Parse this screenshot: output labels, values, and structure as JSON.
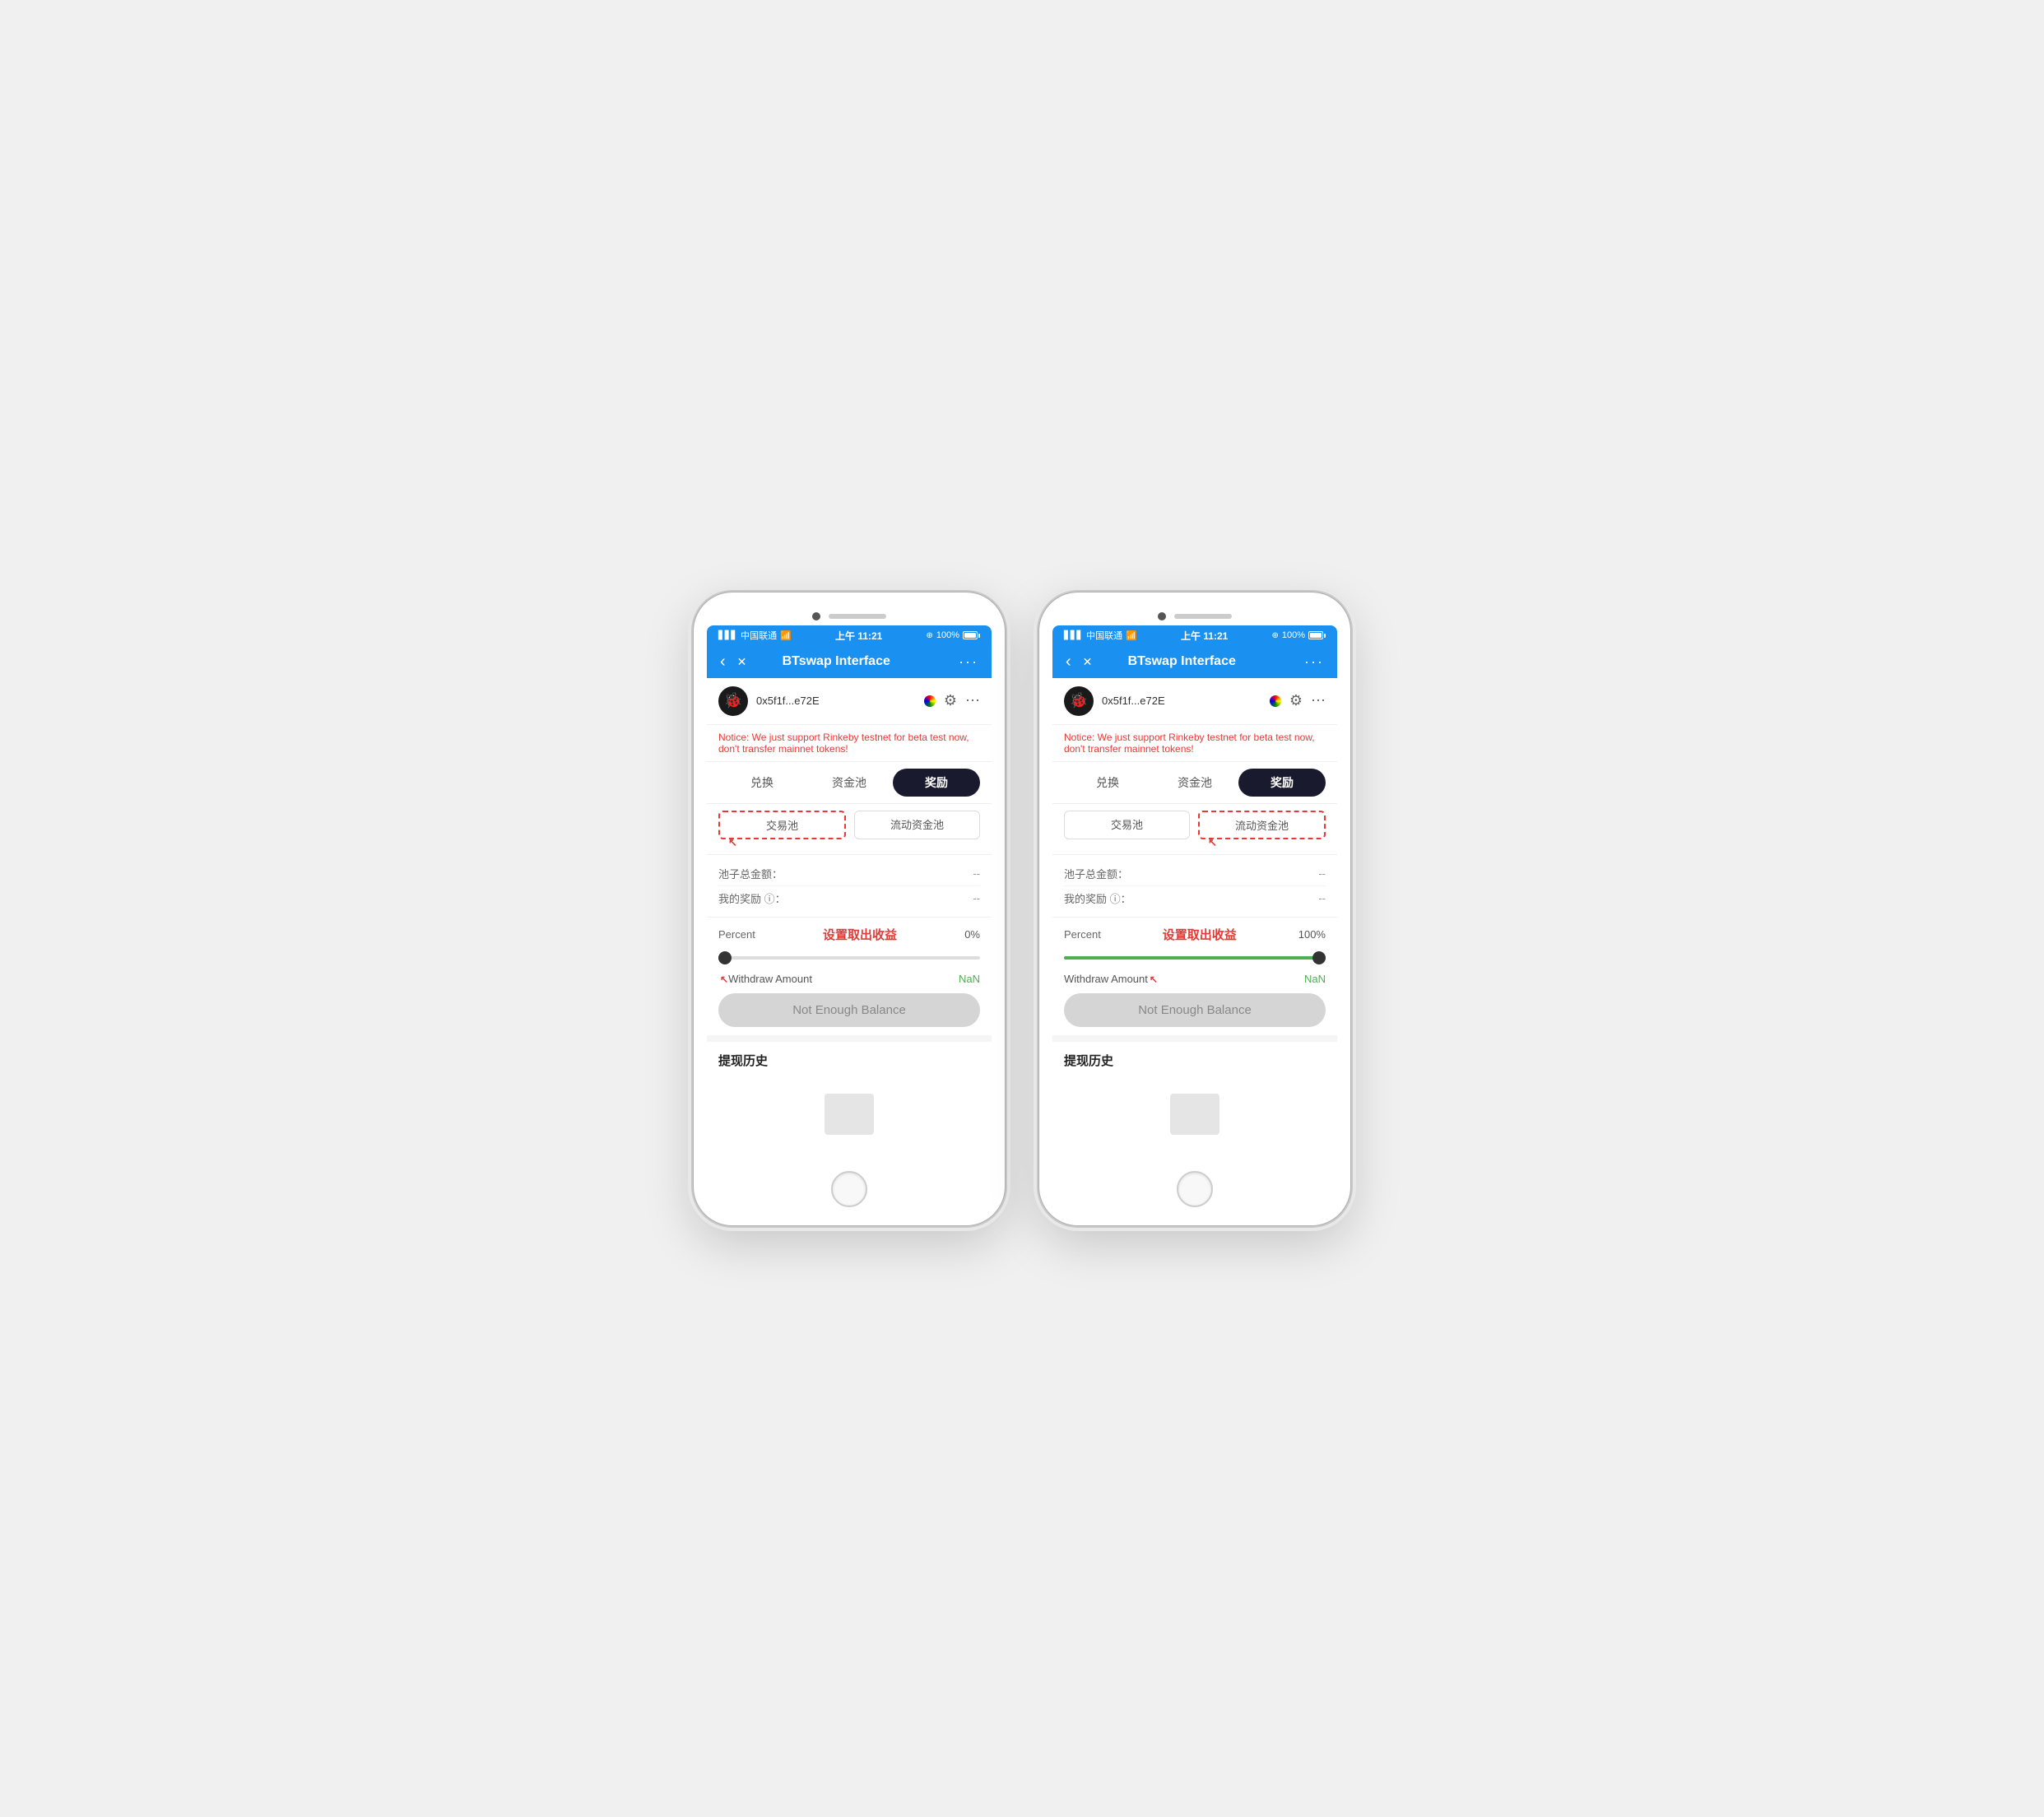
{
  "page": {
    "background": "#f0f0f0"
  },
  "phones": [
    {
      "id": "phone-left",
      "status_bar": {
        "carrier": "中国联通",
        "wifi": "WiFi",
        "time": "上午 11:21",
        "network_icon": "⊕",
        "battery": "100%"
      },
      "app_bar": {
        "back_label": "‹",
        "close_label": "✕",
        "title": "BTswap Interface",
        "more_label": "···"
      },
      "profile": {
        "avatar": "🐞",
        "address": "0x5f1f...e72E",
        "colorful_dot": true,
        "settings_icon": "⚙",
        "more_icon": "⋯"
      },
      "notice": "Notice: We just support Rinkeby testnet for beta test now, don't transfer mainnet tokens!",
      "tabs": [
        {
          "label": "兑换",
          "active": false,
          "dashed": false
        },
        {
          "label": "资金池",
          "active": false,
          "dashed": false
        },
        {
          "label": "奖励",
          "active": true,
          "dashed": true
        }
      ],
      "sub_tabs": [
        {
          "label": "交易池",
          "active": false,
          "dashed": true
        },
        {
          "label": "流动资金池",
          "active": false,
          "dashed": false
        }
      ],
      "active_sub_tab": "交易池",
      "info_rows": [
        {
          "label": "池子总金额：",
          "value": "--"
        },
        {
          "label": "我的奖励 ⓘ：",
          "value": "--"
        }
      ],
      "percent": {
        "label": "Percent",
        "title_cn": "设置取出收益",
        "value": "0%",
        "slider_position": "left"
      },
      "withdraw": {
        "label": "Withdraw Amount",
        "value": "NaN",
        "arrow_side": "left"
      },
      "balance_button": "Not Enough Balance",
      "history": {
        "title": "提现历史"
      }
    },
    {
      "id": "phone-right",
      "status_bar": {
        "carrier": "中国联通",
        "wifi": "WiFi",
        "time": "上午 11:21",
        "network_icon": "⊕",
        "battery": "100%"
      },
      "app_bar": {
        "back_label": "‹",
        "close_label": "✕",
        "title": "BTswap Interface",
        "more_label": "···"
      },
      "profile": {
        "avatar": "🐞",
        "address": "0x5f1f...e72E",
        "colorful_dot": true,
        "settings_icon": "⚙",
        "more_icon": "⋯"
      },
      "notice": "Notice: We just support Rinkeby testnet for beta test now, don't transfer mainnet tokens!",
      "tabs": [
        {
          "label": "兑换",
          "active": false,
          "dashed": false
        },
        {
          "label": "资金池",
          "active": false,
          "dashed": false
        },
        {
          "label": "奖励",
          "active": true,
          "dashed": false
        }
      ],
      "sub_tabs": [
        {
          "label": "交易池",
          "active": false,
          "dashed": false
        },
        {
          "label": "流动资金池",
          "active": false,
          "dashed": true
        }
      ],
      "active_sub_tab": "流动资金池",
      "info_rows": [
        {
          "label": "池子总金额：",
          "value": "--"
        },
        {
          "label": "我的奖励 ⓘ：",
          "value": "--"
        }
      ],
      "percent": {
        "label": "Percent",
        "title_cn": "设置取出收益",
        "value": "100%",
        "slider_position": "right"
      },
      "withdraw": {
        "label": "Withdraw Amount",
        "value": "NaN",
        "arrow_side": "right"
      },
      "balance_button": "Not Enough Balance",
      "history": {
        "title": "提现历史"
      }
    }
  ]
}
